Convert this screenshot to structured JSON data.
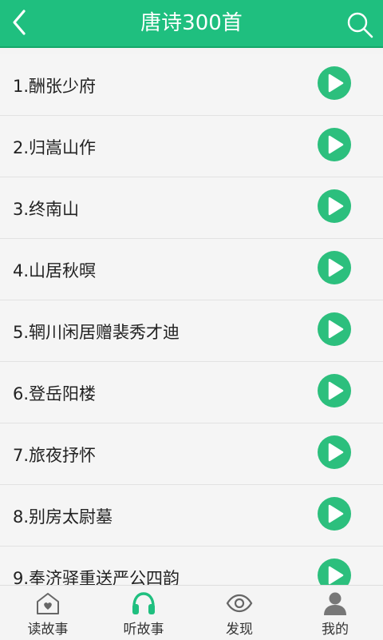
{
  "header": {
    "title": "唐诗300首",
    "back_icon": "chevron-left-icon",
    "search_icon": "search-icon",
    "bg_color": "#1fbf7f"
  },
  "list": {
    "items": [
      {
        "label": "1.酬张少府"
      },
      {
        "label": "2.归嵩山作"
      },
      {
        "label": "3.终南山"
      },
      {
        "label": "4.山居秋暝"
      },
      {
        "label": "5.辋川闲居赠裴秀才迪"
      },
      {
        "label": "6.登岳阳楼"
      },
      {
        "label": "7.旅夜抒怀"
      },
      {
        "label": "8.别房太尉墓"
      },
      {
        "label": "9.奉济驿重送严公四韵"
      }
    ],
    "play_icon": "play-circle-icon",
    "accent_color": "#2cbf7d"
  },
  "tabbar": {
    "tabs": [
      {
        "label": "读故事",
        "icon": "house-heart-icon",
        "active": false
      },
      {
        "label": "听故事",
        "icon": "headphones-icon",
        "active": true
      },
      {
        "label": "发现",
        "icon": "eye-icon",
        "active": false
      },
      {
        "label": "我的",
        "icon": "user-icon",
        "active": false
      }
    ],
    "active_color": "#1fbf7f",
    "inactive_color": "#666666"
  }
}
